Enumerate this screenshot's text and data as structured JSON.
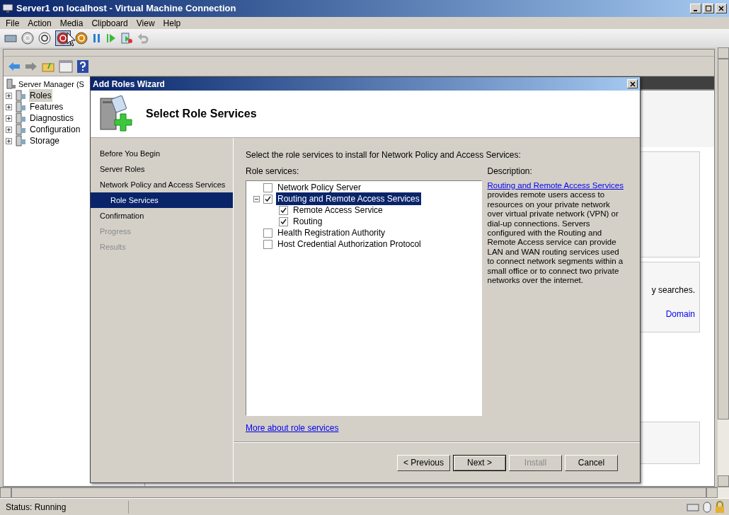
{
  "window": {
    "title": "Server1 on localhost - Virtual Machine Connection"
  },
  "menu": [
    "File",
    "Action",
    "Media",
    "Clipboard",
    "View",
    "Help"
  ],
  "server_manager": {
    "tree_root": "Server Manager (S",
    "tree": [
      {
        "label": "Roles",
        "selected": true
      },
      {
        "label": "Features",
        "selected": false
      },
      {
        "label": "Diagnostics",
        "selected": false
      },
      {
        "label": "Configuration",
        "selected": false
      },
      {
        "label": "Storage",
        "selected": false
      }
    ],
    "background_texts": {
      "search_note": "y searches.",
      "domain_link": "Domain"
    }
  },
  "wizard": {
    "title": "Add Roles Wizard",
    "heading": "Select Role Services",
    "steps": [
      {
        "label": "Before You Begin",
        "selected": false,
        "disabled": false
      },
      {
        "label": "Server Roles",
        "selected": false,
        "disabled": false
      },
      {
        "label": "Network Policy and Access Services",
        "selected": false,
        "disabled": false,
        "children": [
          {
            "label": "Role Services",
            "selected": true,
            "disabled": false
          }
        ]
      },
      {
        "label": "Confirmation",
        "selected": false,
        "disabled": false
      },
      {
        "label": "Progress",
        "selected": false,
        "disabled": true
      },
      {
        "label": "Results",
        "selected": false,
        "disabled": true
      }
    ],
    "instruction": "Select the role services to install for Network Policy and Access Services:",
    "services_label": "Role services:",
    "services": [
      {
        "label": "Network Policy Server",
        "checked": false,
        "selected": false
      },
      {
        "label": "Routing and Remote Access Services",
        "checked": true,
        "selected": true,
        "expanded": true,
        "children": [
          {
            "label": "Remote Access Service",
            "checked": true,
            "selected": false
          },
          {
            "label": "Routing",
            "checked": true,
            "selected": false
          }
        ]
      },
      {
        "label": "Health Registration Authority",
        "checked": false,
        "selected": false
      },
      {
        "label": "Host Credential Authorization Protocol",
        "checked": false,
        "selected": false
      }
    ],
    "description_label": "Description:",
    "description_link": "Routing and Remote Access Services",
    "description_text": "provides remote users access to resources on your private network over virtual private network (VPN) or dial-up connections. Servers configured with the Routing and Remote Access service can provide LAN and WAN routing services used to connect network segments within a small office or to connect two private networks over the internet.",
    "more_link": "More about role services",
    "buttons": [
      {
        "label": "< Previous",
        "disabled": false,
        "default": false
      },
      {
        "label": "Next >",
        "disabled": false,
        "default": true
      },
      {
        "label": "Install",
        "disabled": true,
        "default": false
      },
      {
        "label": "Cancel",
        "disabled": false,
        "default": false
      }
    ]
  },
  "status_bar": {
    "status": "Status: Running"
  }
}
